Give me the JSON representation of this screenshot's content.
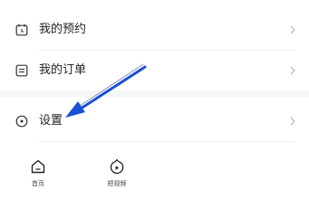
{
  "menu": {
    "items": [
      {
        "label": "我的预约",
        "icon": "calendar-icon",
        "chevron": "›"
      },
      {
        "label": "我的订单",
        "icon": "order-list-icon",
        "chevron": "›"
      },
      {
        "label": "设置",
        "icon": "settings-icon",
        "chevron": "›"
      }
    ]
  },
  "tabbar": {
    "tabs": [
      {
        "label": "首页",
        "icon": "home-icon"
      },
      {
        "label": "短视频",
        "icon": "short-video-icon"
      }
    ]
  },
  "annotation": {
    "icon": "pointer-arrow-icon",
    "color": "#1a4fd6"
  }
}
